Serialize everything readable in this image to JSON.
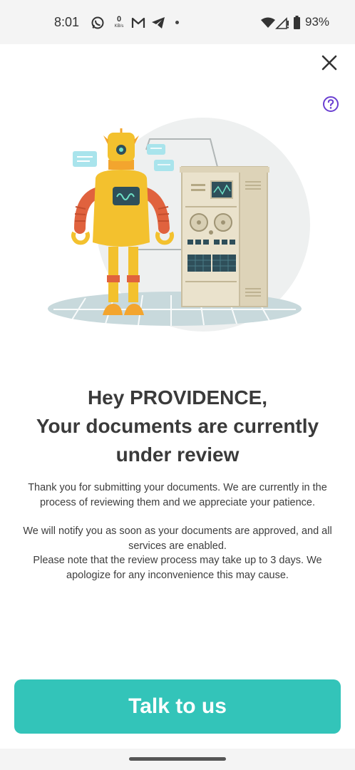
{
  "status_bar": {
    "time": "8:01",
    "net_speed_value": "0",
    "net_speed_unit": "KB/s",
    "battery": "93%",
    "icons": [
      "whatsapp-icon",
      "gmail-icon",
      "telegram-icon",
      "dot-icon",
      "wifi-icon",
      "signal-icon",
      "battery-icon"
    ]
  },
  "header": {
    "close_icon": "close-icon",
    "help_icon": "help-icon"
  },
  "content": {
    "heading_line1": "Hey PROVIDENCE,",
    "heading_line2": "Your documents are currently",
    "heading_line3": "under review",
    "paragraph1": "Thank you for submitting your documents. We are currently in the process of reviewing them and we appreciate your patience.",
    "paragraph2": "We will notify you as soon as your documents are approved, and all services are enabled.",
    "paragraph3": "Please note that the review process may take up to 3 days. We apologize for any inconvenience this may cause."
  },
  "cta": {
    "label": "Talk to us"
  },
  "colors": {
    "accent": "#33c4b9",
    "help_icon": "#6a3fd1",
    "heading": "#3a3a3a"
  }
}
